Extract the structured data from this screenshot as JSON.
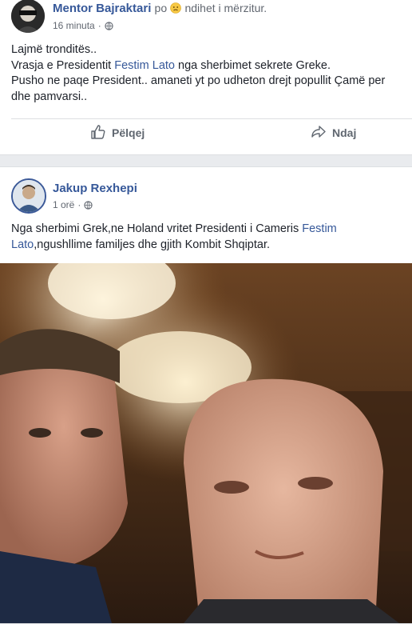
{
  "post1": {
    "author": "Mentor Bajraktari",
    "action_prefix": "po",
    "emoji_icon": "sad-face-emoji",
    "action_suffix": "ndihet i mërzitur.",
    "time": "16 minuta",
    "privacy_icon": "globe-icon",
    "lines": [
      "Lajmë tronditës..",
      "Vrasja e Presidentit",
      "nga sherbimet sekrete Greke.",
      "Pusho ne paqe President.. amaneti yt po udheton drejt popullit Çamë per",
      "dhe pamvarsi.."
    ],
    "mention": "Festim Lato",
    "like_label": "Pëlqej",
    "share_label": "Ndaj"
  },
  "post2": {
    "author": "Jakup Rexhepi",
    "time": "1 orë",
    "privacy_icon": "globe-icon",
    "text_before": "Nga sherbimi Grek,ne Holand vritet Presidenti i Cameris",
    "mention_part1": "Festim",
    "mention_part2": "Lato",
    "text_after": ",ngushllime familjes dhe gjith Kombit Shqiptar."
  },
  "colors": {
    "link": "#365899",
    "text": "#1d2129",
    "meta": "#616770",
    "background": "#e9ebee"
  }
}
